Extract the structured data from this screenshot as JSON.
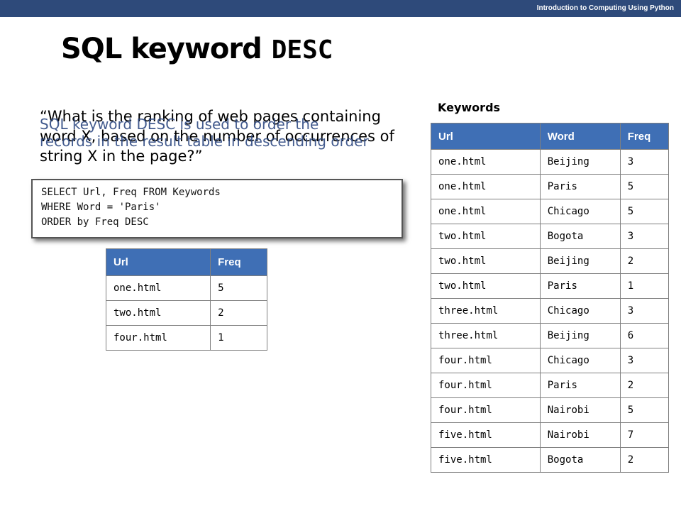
{
  "header": {
    "course": "Introduction to Computing Using Python"
  },
  "slide": {
    "title_prefix": "SQL keyword",
    "title_keyword": "DESC",
    "question": "“What is the ranking of web pages containing word X, based on the number of occurrences of string X in the page?”",
    "description": "SQL keyword DESC is used to order the records in the result table in descending order"
  },
  "sql": {
    "line1": "SELECT Url, Freq FROM Keywords",
    "line2": "WHERE Word = 'Paris'",
    "line3": "ORDER by Freq DESC"
  },
  "result_table": {
    "headers": [
      "Url",
      "Freq"
    ],
    "rows": [
      [
        "one.html",
        "5"
      ],
      [
        "two.html",
        "2"
      ],
      [
        "four.html",
        "1"
      ]
    ]
  },
  "keywords_table": {
    "title": "Keywords",
    "headers": [
      "Url",
      "Word",
      "Freq"
    ],
    "rows": [
      [
        "one.html",
        "Beijing",
        "3"
      ],
      [
        "one.html",
        "Paris",
        "5"
      ],
      [
        "one.html",
        "Chicago",
        "5"
      ],
      [
        "two.html",
        "Bogota",
        "3"
      ],
      [
        "two.html",
        "Beijing",
        "2"
      ],
      [
        "two.html",
        "Paris",
        "1"
      ],
      [
        "three.html",
        "Chicago",
        "3"
      ],
      [
        "three.html",
        "Beijing",
        "6"
      ],
      [
        "four.html",
        "Chicago",
        "3"
      ],
      [
        "four.html",
        "Paris",
        "2"
      ],
      [
        "four.html",
        "Nairobi",
        "5"
      ],
      [
        "five.html",
        "Nairobi",
        "7"
      ],
      [
        "five.html",
        "Bogota",
        "2"
      ]
    ]
  },
  "colors": {
    "header_bar": "#2e4a7a",
    "table_header": "#3f6fb5",
    "description_text": "#2f4a82"
  }
}
